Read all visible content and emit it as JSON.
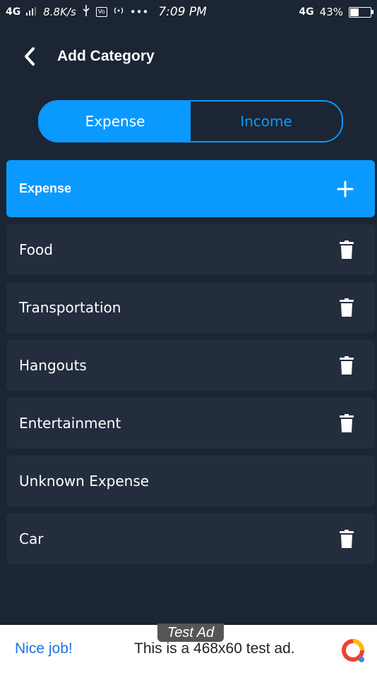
{
  "status_bar": {
    "network": "4G",
    "speed": "8.8K/s",
    "time": "7:09 PM",
    "network_right": "4G",
    "battery": "43%"
  },
  "header": {
    "title": "Add Category",
    "back_icon": "chevron-left-icon"
  },
  "toggle": {
    "options": [
      "Expense",
      "Income"
    ],
    "selected": "Expense"
  },
  "category_header": {
    "label": "Expense",
    "add_icon": "plus-icon"
  },
  "categories": [
    {
      "label": "Food",
      "deletable": true
    },
    {
      "label": "Transportation",
      "deletable": true
    },
    {
      "label": "Hangouts",
      "deletable": true
    },
    {
      "label": "Entertainment",
      "deletable": true
    },
    {
      "label": "Unknown Expense",
      "deletable": false
    },
    {
      "label": "Car",
      "deletable": true
    }
  ],
  "ad": {
    "tag": "Test Ad",
    "headline": "Nice job!",
    "body": "This is a 468x60 test ad."
  },
  "colors": {
    "background": "#1b2533",
    "row": "#232d3d",
    "accent": "#0a9aff"
  }
}
